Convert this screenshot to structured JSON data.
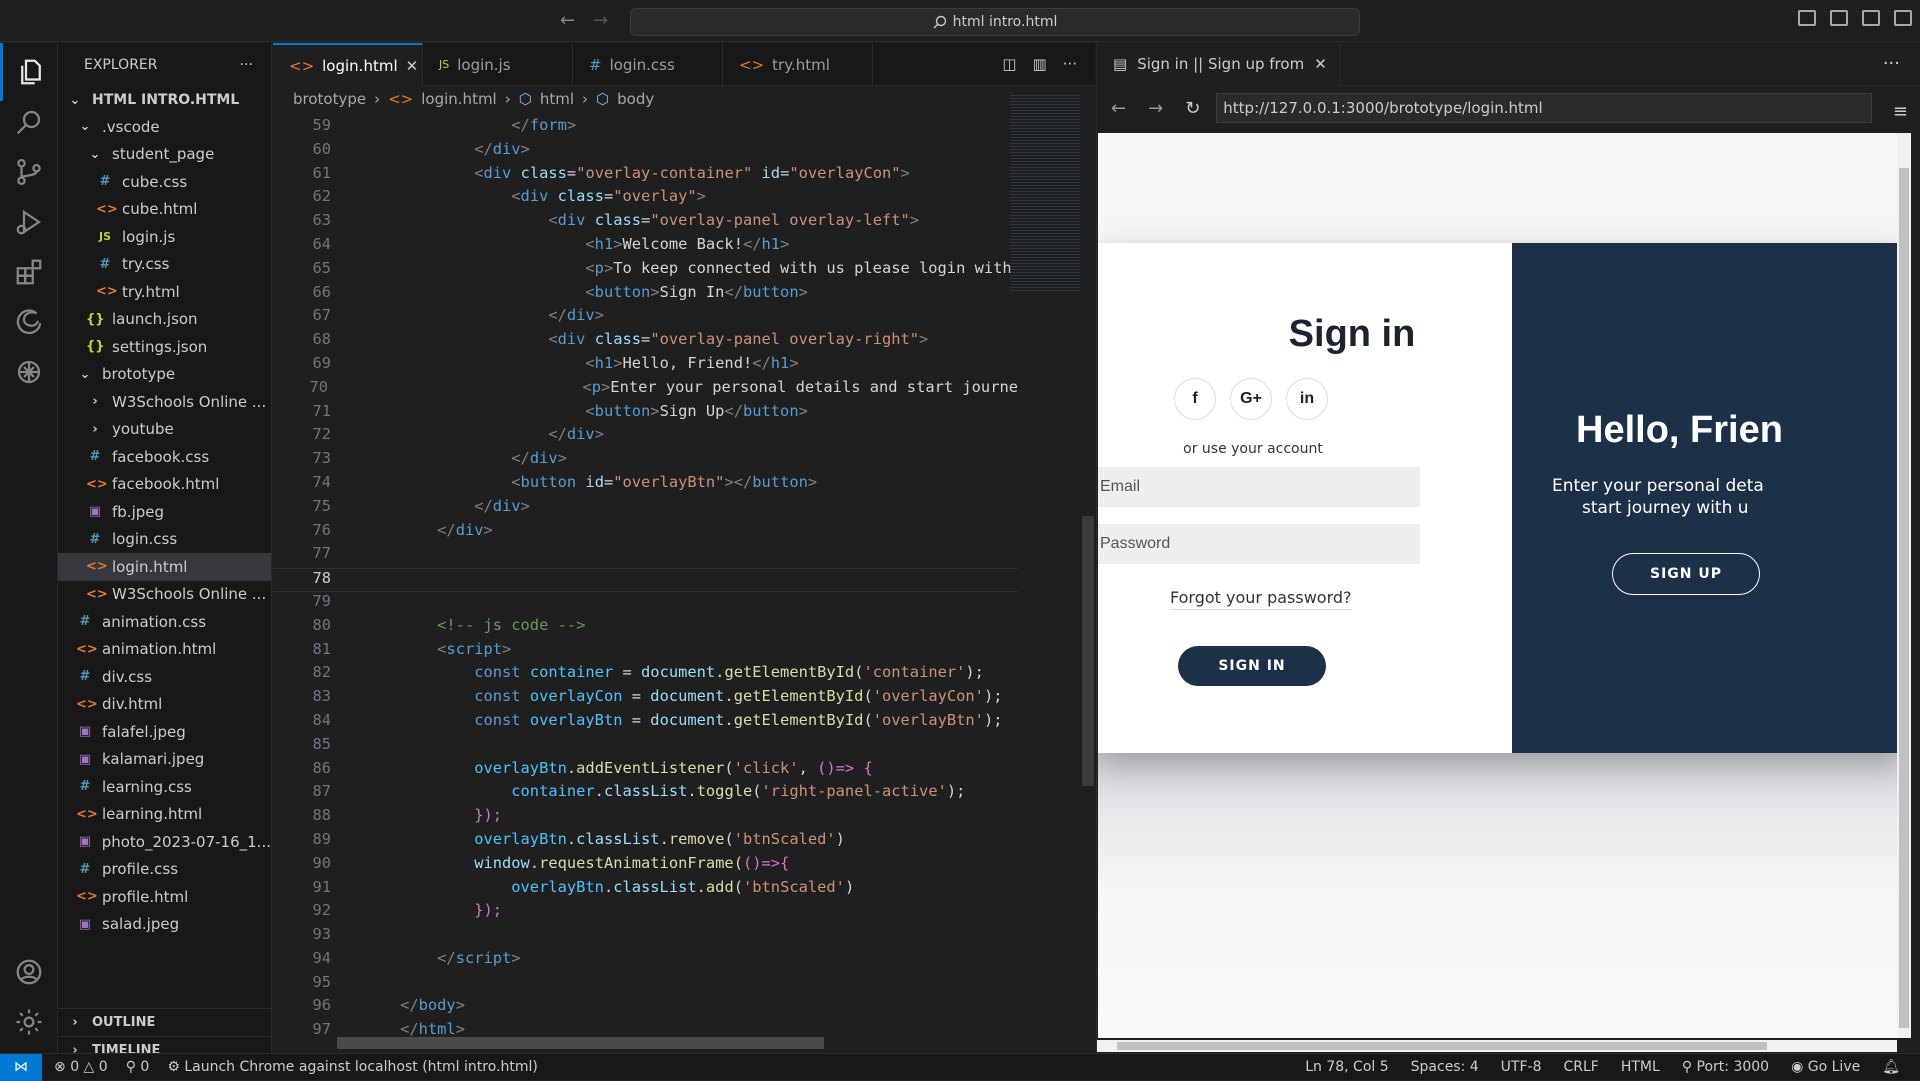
{
  "titlebar": {
    "search": "html intro.html"
  },
  "explorer": {
    "title": "EXPLORER",
    "more": "···",
    "root": "HTML INTRO.HTML",
    "items": [
      {
        "label": ".vscode",
        "icon": "chev-down",
        "indent": 1
      },
      {
        "label": "student_page",
        "icon": "chev-down",
        "indent": 2
      },
      {
        "label": "cube.css",
        "icon": "css",
        "indent": 3
      },
      {
        "label": "cube.html",
        "icon": "html",
        "indent": 3
      },
      {
        "label": "login.js",
        "icon": "js",
        "indent": 3
      },
      {
        "label": "try.css",
        "icon": "css",
        "indent": 3
      },
      {
        "label": "try.html",
        "icon": "html",
        "indent": 3
      },
      {
        "label": "launch.json",
        "icon": "json",
        "indent": 2
      },
      {
        "label": "settings.json",
        "icon": "json",
        "indent": 2
      },
      {
        "label": "brototype",
        "icon": "chev-down",
        "indent": 1
      },
      {
        "label": "W3Schools Online ...",
        "icon": "chev-right",
        "indent": 2
      },
      {
        "label": "youtube",
        "icon": "chev-right",
        "indent": 2
      },
      {
        "label": "facebook.css",
        "icon": "css",
        "indent": 2
      },
      {
        "label": "facebook.html",
        "icon": "html",
        "indent": 2
      },
      {
        "label": "fb.jpeg",
        "icon": "img",
        "indent": 2
      },
      {
        "label": "login.css",
        "icon": "css",
        "indent": 2
      },
      {
        "label": "login.html",
        "icon": "html",
        "indent": 2,
        "selected": true
      },
      {
        "label": "W3Schools Online ...",
        "icon": "html",
        "indent": 2
      },
      {
        "label": "animation.css",
        "icon": "css",
        "indent": 1
      },
      {
        "label": "animation.html",
        "icon": "html",
        "indent": 1
      },
      {
        "label": "div.css",
        "icon": "css",
        "indent": 1
      },
      {
        "label": "div.html",
        "icon": "html",
        "indent": 1
      },
      {
        "label": "falafel.jpeg",
        "icon": "img",
        "indent": 1
      },
      {
        "label": "kalamari.jpeg",
        "icon": "img",
        "indent": 1
      },
      {
        "label": "learning.css",
        "icon": "css",
        "indent": 1
      },
      {
        "label": "learning.html",
        "icon": "html",
        "indent": 1
      },
      {
        "label": "photo_2023-07-16_1...",
        "icon": "img",
        "indent": 1
      },
      {
        "label": "profile.css",
        "icon": "css",
        "indent": 1
      },
      {
        "label": "profile.html",
        "icon": "html",
        "indent": 1
      },
      {
        "label": "salad.jpeg",
        "icon": "img",
        "indent": 1
      }
    ],
    "outline": "OUTLINE",
    "timeline": "TIMELINE"
  },
  "tabs": [
    {
      "label": "login.html",
      "icon": "<>",
      "kind": "html",
      "active": true,
      "close": "✕"
    },
    {
      "label": "login.js",
      "icon": "JS",
      "kind": "js"
    },
    {
      "label": "login.css",
      "icon": "#",
      "kind": "css"
    },
    {
      "label": "try.html",
      "icon": "<>",
      "kind": "html"
    }
  ],
  "breadcrumb": [
    "brototype",
    "login.html",
    "html",
    "body"
  ],
  "code": {
    "current_line": 78,
    "lines": [
      {
        "n": 59,
        "t": [
          [
            "                ",
            ""
          ],
          [
            "</",
            "bk"
          ],
          [
            "form",
            "tg"
          ],
          [
            ">",
            "bk"
          ]
        ]
      },
      {
        "n": 60,
        "t": [
          [
            "            ",
            ""
          ],
          [
            "</",
            "bk"
          ],
          [
            "div",
            "tg"
          ],
          [
            ">",
            "bk"
          ]
        ]
      },
      {
        "n": 61,
        "t": [
          [
            "            ",
            ""
          ],
          [
            "<",
            "bk"
          ],
          [
            "div",
            "tg"
          ],
          [
            " class",
            "at"
          ],
          [
            "=",
            ""
          ],
          [
            "\"overlay-container\"",
            "st"
          ],
          [
            " id",
            "at"
          ],
          [
            "=",
            ""
          ],
          [
            "\"overlayCon\"",
            "st"
          ],
          [
            ">",
            "bk"
          ]
        ]
      },
      {
        "n": 62,
        "t": [
          [
            "                ",
            ""
          ],
          [
            "<",
            "bk"
          ],
          [
            "div",
            "tg"
          ],
          [
            " class",
            "at"
          ],
          [
            "=",
            ""
          ],
          [
            "\"overlay\"",
            "st"
          ],
          [
            ">",
            "bk"
          ]
        ]
      },
      {
        "n": 63,
        "t": [
          [
            "                    ",
            ""
          ],
          [
            "<",
            "bk"
          ],
          [
            "div",
            "tg"
          ],
          [
            " class",
            "at"
          ],
          [
            "=",
            ""
          ],
          [
            "\"overlay-panel overlay-left\"",
            "st"
          ],
          [
            ">",
            "bk"
          ]
        ]
      },
      {
        "n": 64,
        "t": [
          [
            "                        ",
            ""
          ],
          [
            "<",
            "bk"
          ],
          [
            "h1",
            "tg"
          ],
          [
            ">",
            "bk"
          ],
          [
            "Welcome Back!",
            "tx"
          ],
          [
            "</",
            "bk"
          ],
          [
            "h1",
            "tg"
          ],
          [
            ">",
            "bk"
          ]
        ]
      },
      {
        "n": 65,
        "t": [
          [
            "                        ",
            ""
          ],
          [
            "<",
            "bk"
          ],
          [
            "p",
            "tg"
          ],
          [
            ">",
            "bk"
          ],
          [
            "To keep connected with us please login with",
            "tx"
          ]
        ]
      },
      {
        "n": 66,
        "t": [
          [
            "                        ",
            ""
          ],
          [
            "<",
            "bk"
          ],
          [
            "button",
            "tg"
          ],
          [
            ">",
            "bk"
          ],
          [
            "Sign In",
            "tx"
          ],
          [
            "</",
            "bk"
          ],
          [
            "button",
            "tg"
          ],
          [
            ">",
            "bk"
          ]
        ]
      },
      {
        "n": 67,
        "t": [
          [
            "                    ",
            ""
          ],
          [
            "</",
            "bk"
          ],
          [
            "div",
            "tg"
          ],
          [
            ">",
            "bk"
          ]
        ]
      },
      {
        "n": 68,
        "t": [
          [
            "                    ",
            ""
          ],
          [
            "<",
            "bk"
          ],
          [
            "div",
            "tg"
          ],
          [
            " class",
            "at"
          ],
          [
            "=",
            ""
          ],
          [
            "\"overlay-panel overlay-right\"",
            "st"
          ],
          [
            ">",
            "bk"
          ]
        ]
      },
      {
        "n": 69,
        "t": [
          [
            "                        ",
            ""
          ],
          [
            "<",
            "bk"
          ],
          [
            "h1",
            "tg"
          ],
          [
            ">",
            "bk"
          ],
          [
            "Hello, Friend!",
            "tx"
          ],
          [
            "</",
            "bk"
          ],
          [
            "h1",
            "tg"
          ],
          [
            ">",
            "bk"
          ]
        ]
      },
      {
        "n": 70,
        "t": [
          [
            "                        ",
            ""
          ],
          [
            "<",
            "bk"
          ],
          [
            "p",
            "tg"
          ],
          [
            ">",
            "bk"
          ],
          [
            "Enter your personal details and start journe",
            "tx"
          ]
        ]
      },
      {
        "n": 71,
        "t": [
          [
            "                        ",
            ""
          ],
          [
            "<",
            "bk"
          ],
          [
            "button",
            "tg"
          ],
          [
            ">",
            "bk"
          ],
          [
            "Sign Up",
            "tx"
          ],
          [
            "</",
            "bk"
          ],
          [
            "button",
            "tg"
          ],
          [
            ">",
            "bk"
          ]
        ]
      },
      {
        "n": 72,
        "t": [
          [
            "                    ",
            ""
          ],
          [
            "</",
            "bk"
          ],
          [
            "div",
            "tg"
          ],
          [
            ">",
            "bk"
          ]
        ]
      },
      {
        "n": 73,
        "t": [
          [
            "                ",
            ""
          ],
          [
            "</",
            "bk"
          ],
          [
            "div",
            "tg"
          ],
          [
            ">",
            "bk"
          ]
        ]
      },
      {
        "n": 74,
        "t": [
          [
            "                ",
            ""
          ],
          [
            "<",
            "bk"
          ],
          [
            "button",
            "tg"
          ],
          [
            " id",
            "at"
          ],
          [
            "=",
            ""
          ],
          [
            "\"overlayBtn\"",
            "st"
          ],
          [
            "></",
            "bk"
          ],
          [
            "button",
            "tg"
          ],
          [
            ">",
            "bk"
          ]
        ]
      },
      {
        "n": 75,
        "t": [
          [
            "            ",
            ""
          ],
          [
            "</",
            "bk"
          ],
          [
            "div",
            "tg"
          ],
          [
            ">",
            "bk"
          ]
        ]
      },
      {
        "n": 76,
        "t": [
          [
            "        ",
            ""
          ],
          [
            "</",
            "bk"
          ],
          [
            "div",
            "tg"
          ],
          [
            ">",
            "bk"
          ]
        ]
      },
      {
        "n": 77,
        "t": []
      },
      {
        "n": 78,
        "t": []
      },
      {
        "n": 79,
        "t": []
      },
      {
        "n": 80,
        "t": [
          [
            "        ",
            ""
          ],
          [
            "<!-- js code -->",
            "cm"
          ]
        ]
      },
      {
        "n": 81,
        "t": [
          [
            "        ",
            ""
          ],
          [
            "<",
            "bk"
          ],
          [
            "script",
            "tg"
          ],
          [
            ">",
            "bk"
          ]
        ]
      },
      {
        "n": 82,
        "t": [
          [
            "            ",
            ""
          ],
          [
            "const",
            "kw"
          ],
          [
            " container",
            "vr"
          ],
          [
            " = ",
            ""
          ],
          [
            "document",
            "pr"
          ],
          [
            ".",
            ""
          ],
          [
            "getElementById",
            "fn"
          ],
          [
            "(",
            ""
          ],
          [
            "'container'",
            "st"
          ],
          [
            ");",
            ""
          ]
        ]
      },
      {
        "n": 83,
        "t": [
          [
            "            ",
            ""
          ],
          [
            "const",
            "kw"
          ],
          [
            " overlayCon",
            "vr"
          ],
          [
            " = ",
            ""
          ],
          [
            "document",
            "pr"
          ],
          [
            ".",
            ""
          ],
          [
            "getElementById",
            "fn"
          ],
          [
            "(",
            ""
          ],
          [
            "'overlayCon'",
            "st"
          ],
          [
            ");",
            ""
          ]
        ]
      },
      {
        "n": 84,
        "t": [
          [
            "            ",
            ""
          ],
          [
            "const",
            "kw"
          ],
          [
            " overlayBtn",
            "vr"
          ],
          [
            " = ",
            ""
          ],
          [
            "document",
            "pr"
          ],
          [
            ".",
            ""
          ],
          [
            "getElementById",
            "fn"
          ],
          [
            "(",
            ""
          ],
          [
            "'overlayBtn'",
            "st"
          ],
          [
            ");",
            ""
          ]
        ]
      },
      {
        "n": 85,
        "t": []
      },
      {
        "n": 86,
        "t": [
          [
            "            ",
            ""
          ],
          [
            "overlayBtn",
            "vr"
          ],
          [
            ".",
            ""
          ],
          [
            "addEventListener",
            "fn"
          ],
          [
            "(",
            ""
          ],
          [
            "'click'",
            "st"
          ],
          [
            ", ",
            ""
          ],
          [
            "()=> {",
            "pk"
          ]
        ]
      },
      {
        "n": 87,
        "t": [
          [
            "                ",
            ""
          ],
          [
            "container",
            "vr"
          ],
          [
            ".",
            ""
          ],
          [
            "classList",
            "pr"
          ],
          [
            ".",
            ""
          ],
          [
            "toggle",
            "fn"
          ],
          [
            "(",
            ""
          ],
          [
            "'right-panel-active'",
            "st"
          ],
          [
            ");",
            ""
          ]
        ]
      },
      {
        "n": 88,
        "t": [
          [
            "            ",
            ""
          ],
          [
            "});",
            "pk"
          ]
        ]
      },
      {
        "n": 89,
        "t": [
          [
            "            ",
            ""
          ],
          [
            "overlayBtn",
            "vr"
          ],
          [
            ".",
            ""
          ],
          [
            "classList",
            "pr"
          ],
          [
            ".",
            ""
          ],
          [
            "remove",
            "fn"
          ],
          [
            "(",
            ""
          ],
          [
            "'btnScaled'",
            "st"
          ],
          [
            ")",
            ""
          ]
        ]
      },
      {
        "n": 90,
        "t": [
          [
            "            ",
            ""
          ],
          [
            "window",
            "pr"
          ],
          [
            ".",
            ""
          ],
          [
            "requestAnimationFrame",
            "fn"
          ],
          [
            "(",
            ""
          ],
          [
            "()=>{",
            "pk"
          ]
        ]
      },
      {
        "n": 91,
        "t": [
          [
            "                ",
            ""
          ],
          [
            "overlayBtn",
            "vr"
          ],
          [
            ".",
            ""
          ],
          [
            "classList",
            "pr"
          ],
          [
            ".",
            ""
          ],
          [
            "add",
            "fn"
          ],
          [
            "(",
            ""
          ],
          [
            "'btnScaled'",
            "st"
          ],
          [
            ")",
            ""
          ]
        ]
      },
      {
        "n": 92,
        "t": [
          [
            "            ",
            ""
          ],
          [
            "});",
            "pk"
          ]
        ]
      },
      {
        "n": 93,
        "t": []
      },
      {
        "n": 94,
        "t": [
          [
            "        ",
            ""
          ],
          [
            "</",
            "bk"
          ],
          [
            "script",
            "tg"
          ],
          [
            ">",
            "bk"
          ]
        ]
      },
      {
        "n": 95,
        "t": []
      },
      {
        "n": 96,
        "t": [
          [
            "    ",
            ""
          ],
          [
            "</",
            "bk"
          ],
          [
            "body",
            "tg"
          ],
          [
            ">",
            "bk"
          ]
        ]
      },
      {
        "n": 97,
        "t": [
          [
            "    ",
            ""
          ],
          [
            "</",
            "bk"
          ],
          [
            "html",
            "tg"
          ],
          [
            ">",
            "bk"
          ]
        ]
      }
    ]
  },
  "browser": {
    "tab_title": "Sign in || Sign up from",
    "tab_close": "✕",
    "more": "···",
    "url": "http://127.0.0.1:3000/brototype/login.html",
    "page": {
      "signin_title": "Sign in",
      "socials": [
        "f",
        "G+",
        "in"
      ],
      "use_account": "or use your account",
      "email_placeholder": "Email",
      "password_placeholder": "Password",
      "forgot": "Forgot your password?",
      "signin_button": "SIGN IN",
      "hello": "Hello, Frien",
      "enter_line1": "Enter your personal deta",
      "enter_line2": "start journey with u",
      "signup_button": "SIGN UP"
    }
  },
  "status": {
    "errors": "0",
    "warnings": "0",
    "ports": "0",
    "launch": "Launch Chrome against localhost (html intro.html)",
    "position": "Ln 78, Col 5",
    "spaces": "Spaces: 4",
    "encoding": "UTF-8",
    "eol": "CRLF",
    "language": "HTML",
    "port": "Port: 3000",
    "golive": "Go Live"
  },
  "colors": {
    "accent": "#0078d4",
    "panel_dark": "#1c3048"
  }
}
